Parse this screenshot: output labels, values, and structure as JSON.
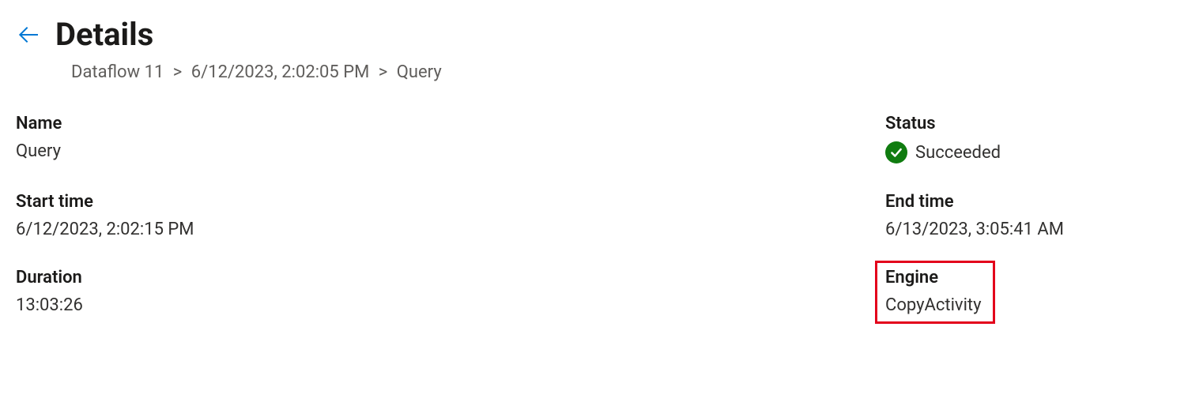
{
  "header": {
    "title": "Details"
  },
  "breadcrumb": {
    "item1": "Dataflow 11",
    "item2": "6/12/2023, 2:02:05 PM",
    "item3": "Query",
    "sep": ">"
  },
  "fields": {
    "name_label": "Name",
    "name_value": "Query",
    "status_label": "Status",
    "status_value": "Succeeded",
    "start_label": "Start time",
    "start_value": "6/12/2023, 2:02:15 PM",
    "end_label": "End time",
    "end_value": "6/13/2023, 3:05:41 AM",
    "duration_label": "Duration",
    "duration_value": "13:03:26",
    "engine_label": "Engine",
    "engine_value": "CopyActivity"
  }
}
